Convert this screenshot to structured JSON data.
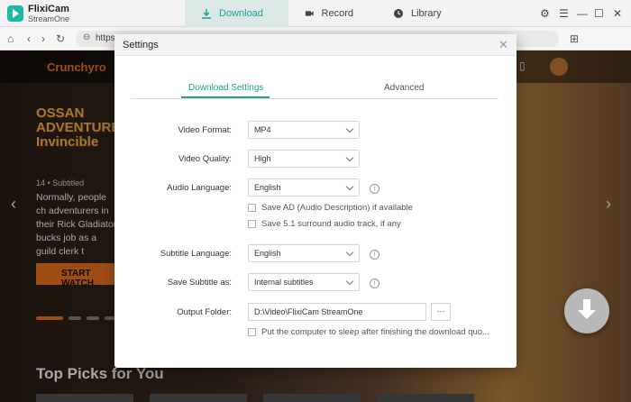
{
  "app": {
    "name": "FlixiCam",
    "subtitle": "StreamOne"
  },
  "modes": [
    {
      "label": "Download"
    },
    {
      "label": "Record"
    },
    {
      "label": "Library"
    }
  ],
  "address": {
    "url": "https"
  },
  "site": {
    "logo": "Crunchyro",
    "show_title": "OSSAN ADVENTURER Invincible",
    "meta": "14 • Subtitled",
    "description": "Normally, people ch adventurers in their Rick Gladiator bucks job as a guild clerk t",
    "watch_label": "START WATCH",
    "section": "Top Picks for You"
  },
  "settings": {
    "title": "Settings",
    "tabs": {
      "download": "Download Settings",
      "advanced": "Advanced"
    },
    "video_format": {
      "label": "Video Format:",
      "value": "MP4"
    },
    "video_quality": {
      "label": "Video Quality:",
      "value": "High"
    },
    "audio_language": {
      "label": "Audio Language:",
      "value": "English"
    },
    "save_ad": "Save AD (Audio Description) if available",
    "save_51": "Save 5.1 surround audio track, if any",
    "subtitle_language": {
      "label": "Subtitle Language:",
      "value": "English"
    },
    "save_subtitle": {
      "label": "Save Subtitle as:",
      "value": "Internal subtitles"
    },
    "output_folder": {
      "label": "Output Folder:",
      "value": "D:\\Video\\FlixiCam StreamOne",
      "browse": "···"
    },
    "sleep": "Put the computer to sleep after finishing the download quo..."
  },
  "icons": [
    "download-icon",
    "record-icon",
    "library-icon",
    "home-icon",
    "back-icon",
    "forward-icon",
    "refresh-icon",
    "lock-icon",
    "extensions-icon",
    "settings-gear-icon",
    "menu-icon",
    "bookmark-icon",
    "info-icon",
    "close-icon",
    "chevron-down-icon"
  ],
  "colors": {
    "accent": "#1aa393",
    "brand": "#f47521"
  }
}
